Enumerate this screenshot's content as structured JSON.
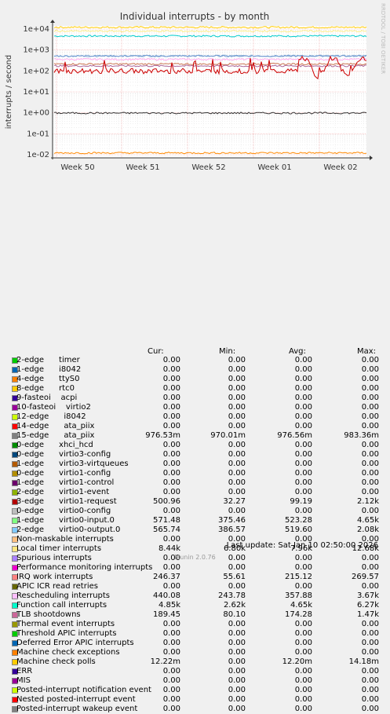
{
  "chart_data": {
    "type": "line",
    "title": "Individual interrupts - by month",
    "ylabel": "interrupts / second",
    "side_label": "RRDTOOL / TOBI OETIKER",
    "yscale": "log",
    "ylim": [
      0.01,
      10000
    ],
    "y_ticks": [
      "1e-02",
      "1e-01",
      "1e+00",
      "1e+01",
      "1e+02",
      "1e+03",
      "1e+04"
    ],
    "x_ticks": [
      "Week 50",
      "Week 51",
      "Week 52",
      "Week 01",
      "Week 02"
    ],
    "series_levels": [
      {
        "name": "Function call interrupts",
        "color": "#00cccc",
        "value": 4650
      },
      {
        "name": "Machine check polls",
        "color": "#ffcc00",
        "value": 12200
      },
      {
        "name": "virtio0-input.0",
        "color": "#8fb3d9",
        "value": 523
      },
      {
        "name": "virtio0-output.0",
        "color": "#6f9ad1",
        "value": 520
      },
      {
        "name": "Rescheduling interrupts",
        "color": "#ffaaee",
        "value": 358
      },
      {
        "name": "IRQ work interrupts",
        "color": "#cc7755",
        "value": 215
      },
      {
        "name": "TLB shootdowns",
        "color": "#aa6699",
        "value": 174
      },
      {
        "name": "virtio1-request",
        "color": "#cc0000",
        "value": 99
      },
      {
        "name": "Local timer interrupts",
        "color": "#ffee88",
        "value": 7960
      },
      {
        "name": "ata_piix",
        "color": "#333333",
        "value": 0.977
      },
      {
        "name": "Machine check exceptions",
        "color": "#ff8800",
        "value": 0.0122
      }
    ]
  },
  "legend": {
    "headers": {
      "cur": "Cur:",
      "min": "Min:",
      "avg": "Avg:",
      "max": "Max:"
    },
    "rows": [
      {
        "label": "2-edge      timer",
        "color": "#00cc00",
        "cur": "0.00",
        "min": "0.00",
        "avg": "0.00",
        "max": "0.00"
      },
      {
        "label": "1-edge      i8042",
        "color": "#0066b3",
        "cur": "0.00",
        "min": "0.00",
        "avg": "0.00",
        "max": "0.00"
      },
      {
        "label": "4-edge      ttyS0",
        "color": "#ff8000",
        "cur": "0.00",
        "min": "0.00",
        "avg": "0.00",
        "max": "0.00"
      },
      {
        "label": "8-edge      rtc0",
        "color": "#ffcc00",
        "cur": "0.00",
        "min": "0.00",
        "avg": "0.00",
        "max": "0.00"
      },
      {
        "label": "9-fasteoi    acpi",
        "color": "#330099",
        "cur": "0.00",
        "min": "0.00",
        "avg": "0.00",
        "max": "0.00"
      },
      {
        "label": "10-fasteoi    virtio2",
        "color": "#990099",
        "cur": "0.00",
        "min": "0.00",
        "avg": "0.00",
        "max": "0.00"
      },
      {
        "label": "12-edge      i8042",
        "color": "#ccff00",
        "cur": "0.00",
        "min": "0.00",
        "avg": "0.00",
        "max": "0.00"
      },
      {
        "label": "14-edge      ata_piix",
        "color": "#ff0000",
        "cur": "0.00",
        "min": "0.00",
        "avg": "0.00",
        "max": "0.00"
      },
      {
        "label": "15-edge      ata_piix",
        "color": "#808080",
        "cur": "976.53m",
        "min": "970.01m",
        "avg": "976.56m",
        "max": "983.36m"
      },
      {
        "label": "0-edge      xhci_hcd",
        "color": "#008f00",
        "cur": "0.00",
        "min": "0.00",
        "avg": "0.00",
        "max": "0.00"
      },
      {
        "label": "0-edge      virtio3-config",
        "color": "#00487d",
        "cur": "0.00",
        "min": "0.00",
        "avg": "0.00",
        "max": "0.00"
      },
      {
        "label": "1-edge      virtio3-virtqueues",
        "color": "#b35a00",
        "cur": "0.00",
        "min": "0.00",
        "avg": "0.00",
        "max": "0.00"
      },
      {
        "label": "0-edge      virtio1-config",
        "color": "#b38f00",
        "cur": "0.00",
        "min": "0.00",
        "avg": "0.00",
        "max": "0.00"
      },
      {
        "label": "1-edge      virtio1-control",
        "color": "#6b006b",
        "cur": "0.00",
        "min": "0.00",
        "avg": "0.00",
        "max": "0.00"
      },
      {
        "label": "2-edge      virtio1-event",
        "color": "#8fb300",
        "cur": "0.00",
        "min": "0.00",
        "avg": "0.00",
        "max": "0.00"
      },
      {
        "label": "3-edge      virtio1-request",
        "color": "#b30000",
        "cur": "500.96",
        "min": "32.27",
        "avg": "99.19",
        "max": "2.12k"
      },
      {
        "label": "0-edge      virtio0-config",
        "color": "#bebebe",
        "cur": "0.00",
        "min": "0.00",
        "avg": "0.00",
        "max": "0.00"
      },
      {
        "label": "1-edge      virtio0-input.0",
        "color": "#80ff80",
        "cur": "571.48",
        "min": "375.46",
        "avg": "523.28",
        "max": "4.65k"
      },
      {
        "label": "2-edge      virtio0-output.0",
        "color": "#80c9ff",
        "cur": "565.74",
        "min": "386.57",
        "avg": "519.60",
        "max": "2.08k"
      },
      {
        "label": "Non-maskable interrupts",
        "color": "#ffc080",
        "cur": "0.00",
        "min": "0.00",
        "avg": "0.00",
        "max": "0.00"
      },
      {
        "label": "Local timer interrupts",
        "color": "#ffe680",
        "cur": "8.44k",
        "min": "6.80k",
        "avg": "7.96k",
        "max": "12.68k"
      },
      {
        "label": "Spurious interrupts",
        "color": "#aa80ff",
        "cur": "0.00",
        "min": "0.00",
        "avg": "0.00",
        "max": "0.00"
      },
      {
        "label": "Performance monitoring interrupts",
        "color": "#ee00cc",
        "cur": "0.00",
        "min": "0.00",
        "avg": "0.00",
        "max": "0.00"
      },
      {
        "label": "IRQ work interrupts",
        "color": "#ff8080",
        "cur": "246.37",
        "min": "55.61",
        "avg": "215.12",
        "max": "269.57"
      },
      {
        "label": "APIC ICR read retries",
        "color": "#666600",
        "cur": "0.00",
        "min": "0.00",
        "avg": "0.00",
        "max": "0.00"
      },
      {
        "label": "Rescheduling interrupts",
        "color": "#ffbfff",
        "cur": "440.08",
        "min": "243.78",
        "avg": "357.88",
        "max": "3.67k"
      },
      {
        "label": "Function call interrupts",
        "color": "#00ffcc",
        "cur": "4.85k",
        "min": "2.62k",
        "avg": "4.65k",
        "max": "6.27k"
      },
      {
        "label": "TLB shootdowns",
        "color": "#cc6699",
        "cur": "189.45",
        "min": "80.10",
        "avg": "174.28",
        "max": "1.47k"
      },
      {
        "label": "Thermal event interrupts",
        "color": "#999900",
        "cur": "0.00",
        "min": "0.00",
        "avg": "0.00",
        "max": "0.00"
      },
      {
        "label": "Threshold APIC interrupts",
        "color": "#00cc00",
        "cur": "0.00",
        "min": "0.00",
        "avg": "0.00",
        "max": "0.00"
      },
      {
        "label": "Deferred Error APIC interrupts",
        "color": "#0066b3",
        "cur": "0.00",
        "min": "0.00",
        "avg": "0.00",
        "max": "0.00"
      },
      {
        "label": "Machine check exceptions",
        "color": "#ff8000",
        "cur": "0.00",
        "min": "0.00",
        "avg": "0.00",
        "max": "0.00"
      },
      {
        "label": "Machine check polls",
        "color": "#ffcc00",
        "cur": "12.22m",
        "min": "0.00",
        "avg": "12.20m",
        "max": "14.18m"
      },
      {
        "label": "ERR",
        "color": "#330099",
        "cur": "0.00",
        "min": "0.00",
        "avg": "0.00",
        "max": "0.00"
      },
      {
        "label": "MIS",
        "color": "#990099",
        "cur": "0.00",
        "min": "0.00",
        "avg": "0.00",
        "max": "0.00"
      },
      {
        "label": "Posted-interrupt notification event",
        "color": "#ccff00",
        "cur": "0.00",
        "min": "0.00",
        "avg": "0.00",
        "max": "0.00"
      },
      {
        "label": "Nested posted-interrupt event",
        "color": "#ff0000",
        "cur": "0.00",
        "min": "0.00",
        "avg": "0.00",
        "max": "0.00"
      },
      {
        "label": "Posted-interrupt wakeup event",
        "color": "#808080",
        "cur": "0.00",
        "min": "0.00",
        "avg": "0.00",
        "max": "0.00"
      }
    ]
  },
  "footer": {
    "last_update": "Last update: Sat Jan 10 02:50:00 2026",
    "munin": "Munin 2.0.76"
  }
}
